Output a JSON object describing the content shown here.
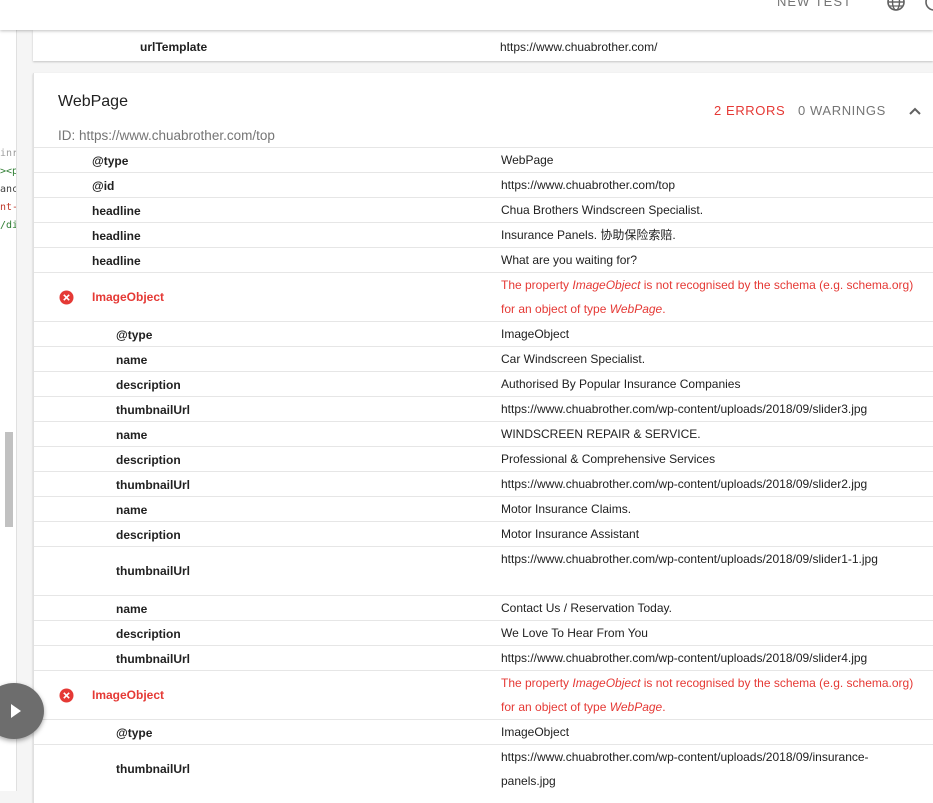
{
  "header": {
    "new_test_label": "NEW TEST"
  },
  "previous_card": {
    "key": "urlTemplate",
    "value": "https://www.chuabrother.com/"
  },
  "card": {
    "title": "WebPage",
    "errors_label": "2 ERRORS",
    "warnings_label": "0 WARNINGS",
    "id_text": "ID: https://www.chuabrother.com/top",
    "error_text_prefix": "The property ",
    "error_text_mid": " is not recognised by the schema (e.g. schema.org) for an object of type ",
    "error_text_suffix": ".",
    "error_property": "ImageObject",
    "error_type": "WebPage",
    "rows": [
      {
        "key": "@type",
        "value": "WebPage"
      },
      {
        "key": "@id",
        "value": "https://www.chuabrother.com/top"
      },
      {
        "key": "headline",
        "value": "Chua Brothers Windscreen Specialist."
      },
      {
        "key": "headline",
        "value": "Insurance Panels. 协助保险索赔."
      },
      {
        "key": "headline",
        "value": "What are you waiting for?"
      },
      {
        "key": "ImageObject"
      },
      {
        "key": "@type",
        "value": "ImageObject"
      },
      {
        "key": "name",
        "value": "Car Windscreen Specialist."
      },
      {
        "key": "description",
        "value": "Authorised By Popular Insurance Companies"
      },
      {
        "key": "thumbnailUrl",
        "value": "https://www.chuabrother.com/wp-content/uploads/2018/09/slider3.jpg"
      },
      {
        "key": "name",
        "value": "WINDSCREEN REPAIR & SERVICE."
      },
      {
        "key": "description",
        "value": "Professional & Comprehensive Services"
      },
      {
        "key": "thumbnailUrl",
        "value": "https://www.chuabrother.com/wp-content/uploads/2018/09/slider2.jpg"
      },
      {
        "key": "name",
        "value": "Motor Insurance Claims."
      },
      {
        "key": "description",
        "value": "Motor Insurance Assistant"
      },
      {
        "key": "thumbnailUrl",
        "value": "https://www.chuabrother.com/wp-content/uploads/2018/09/slider1-1.jpg"
      },
      {
        "key": "name",
        "value": "Contact Us / Reservation Today."
      },
      {
        "key": "description",
        "value": "We Love To Hear From You"
      },
      {
        "key": "thumbnailUrl",
        "value": "https://www.chuabrother.com/wp-content/uploads/2018/09/slider4.jpg"
      },
      {
        "key": "ImageObject"
      },
      {
        "key": "@type",
        "value": "ImageObject"
      },
      {
        "key": "thumbnailUrl",
        "value": "https://www.chuabrother.com/wp-content/uploads/2018/09/insurance-panels.jpg"
      }
    ]
  },
  "code_fragments": [
    "inr",
    "><p",
    "anc",
    "nt-",
    "/di"
  ],
  "colors": {
    "error": "#e53935",
    "muted": "#757575",
    "code_red": "#c0392b",
    "code_green": "#2e7d32"
  },
  "icons": {
    "globe": "globe-icon",
    "collapse": "chevron-up-icon",
    "error": "error-circle-icon",
    "play": "play-icon"
  }
}
